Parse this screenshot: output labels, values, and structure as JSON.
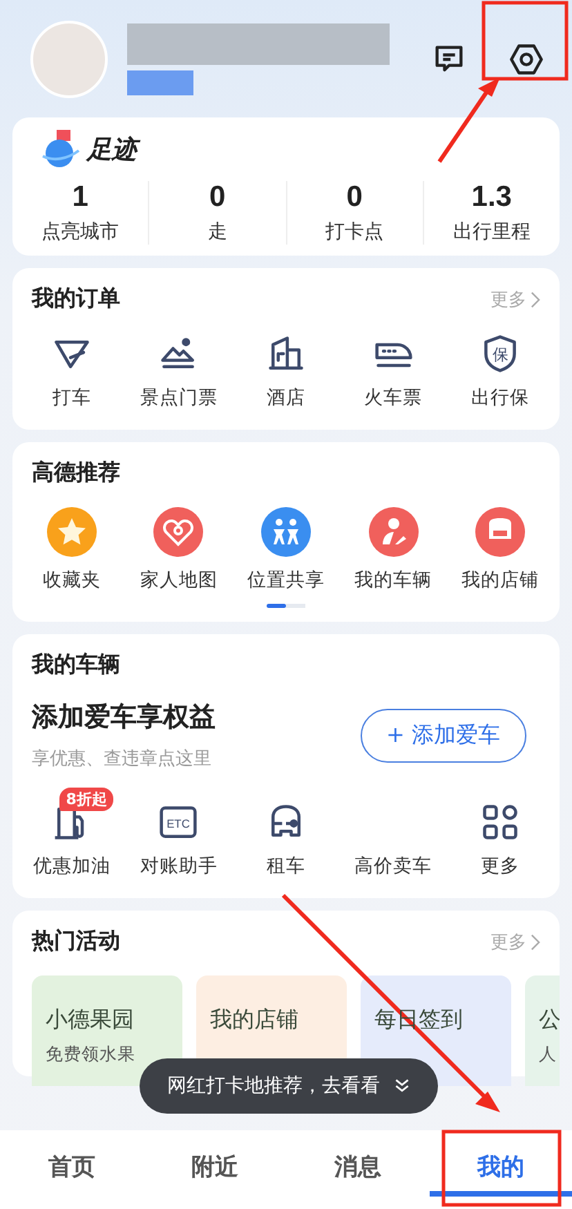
{
  "footprint": {
    "title": "足迹",
    "stats": [
      {
        "value": "1",
        "label": "点亮城市"
      },
      {
        "value": "0",
        "label": "走"
      },
      {
        "value": "0",
        "label": "打卡点"
      },
      {
        "value": "1.3",
        "label": "出行里程"
      }
    ]
  },
  "orders": {
    "title": "我的订单",
    "more": "更多",
    "items": [
      {
        "label": "打车",
        "kind": "taxi"
      },
      {
        "label": "景点门票",
        "kind": "scenic"
      },
      {
        "label": "酒店",
        "kind": "hotel"
      },
      {
        "label": "火车票",
        "kind": "train"
      },
      {
        "label": "出行保",
        "kind": "insurance",
        "glyph": "保"
      }
    ]
  },
  "recommend": {
    "title": "高德推荐",
    "items": [
      {
        "label": "收藏夹",
        "kind": "star",
        "color": "#f9a11b"
      },
      {
        "label": "家人地图",
        "kind": "heart",
        "color": "#f0605c"
      },
      {
        "label": "位置共享",
        "kind": "people",
        "color": "#3a8ef0"
      },
      {
        "label": "我的车辆",
        "kind": "person",
        "color": "#f0605c"
      },
      {
        "label": "我的店铺",
        "kind": "shop",
        "color": "#f0605c"
      }
    ],
    "pager": [
      {
        "selected": true
      },
      {
        "selected": false
      }
    ]
  },
  "vehicle": {
    "title": "我的车辆",
    "headline": "添加爱车享权益",
    "subtitle": "享优惠、查违章点这里",
    "button": "+ 添加爱车",
    "tools": [
      {
        "label": "优惠加油",
        "kind": "fuel",
        "badge": "8折起"
      },
      {
        "label": "对账助手",
        "kind": "etc",
        "glyph": "ETC"
      },
      {
        "label": "租车",
        "kind": "rental"
      },
      {
        "label": "高价卖车",
        "kind": "none"
      },
      {
        "label": "更多",
        "kind": "grid"
      }
    ]
  },
  "hot": {
    "title": "热门活动",
    "more": "更多",
    "cards": [
      {
        "title": "小德果园",
        "subtitle": "免费领水果",
        "color": "#e3f2df"
      },
      {
        "title": "我的店铺",
        "color": "#fdeee2"
      },
      {
        "title": "每日签到",
        "color": "#e5ebfb"
      },
      {
        "title": "公",
        "subtitle": "人",
        "color": "#e6f3ea"
      }
    ]
  },
  "toast": {
    "text": "网红打卡地推荐，去看看"
  },
  "tabs": [
    {
      "label": "首页",
      "selected": false
    },
    {
      "label": "附近",
      "selected": false
    },
    {
      "label": "消息",
      "selected": false
    },
    {
      "label": "我的",
      "selected": true
    }
  ]
}
